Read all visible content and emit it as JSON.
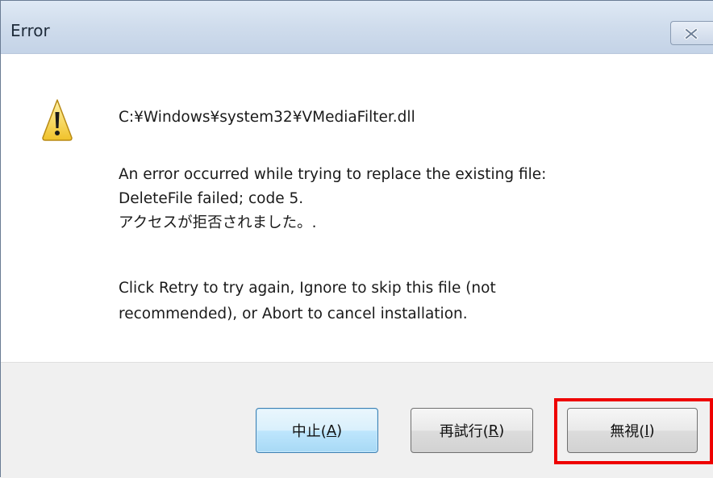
{
  "window": {
    "title": "Error",
    "close_icon": "close-icon"
  },
  "message": {
    "icon": "warning-icon",
    "path": "C:¥Windows¥system32¥VMediaFilter.dll",
    "error_line1": "An error occurred while trying to replace the existing file:",
    "error_line2": "DeleteFile failed; code 5.",
    "error_line3": "アクセスが拒否されました。.",
    "hint_line1": "Click Retry to try again, Ignore to skip this file (not",
    "hint_line2": "recommended), or Abort to cancel installation."
  },
  "buttons": {
    "abort": {
      "label": "中止(",
      "mnemonic": "A",
      "suffix": ")"
    },
    "retry": {
      "label": "再試行(",
      "mnemonic": "R",
      "suffix": ")"
    },
    "ignore": {
      "label": "無視(",
      "mnemonic": "I",
      "suffix": ")"
    }
  },
  "highlight_color": "#ee0000"
}
